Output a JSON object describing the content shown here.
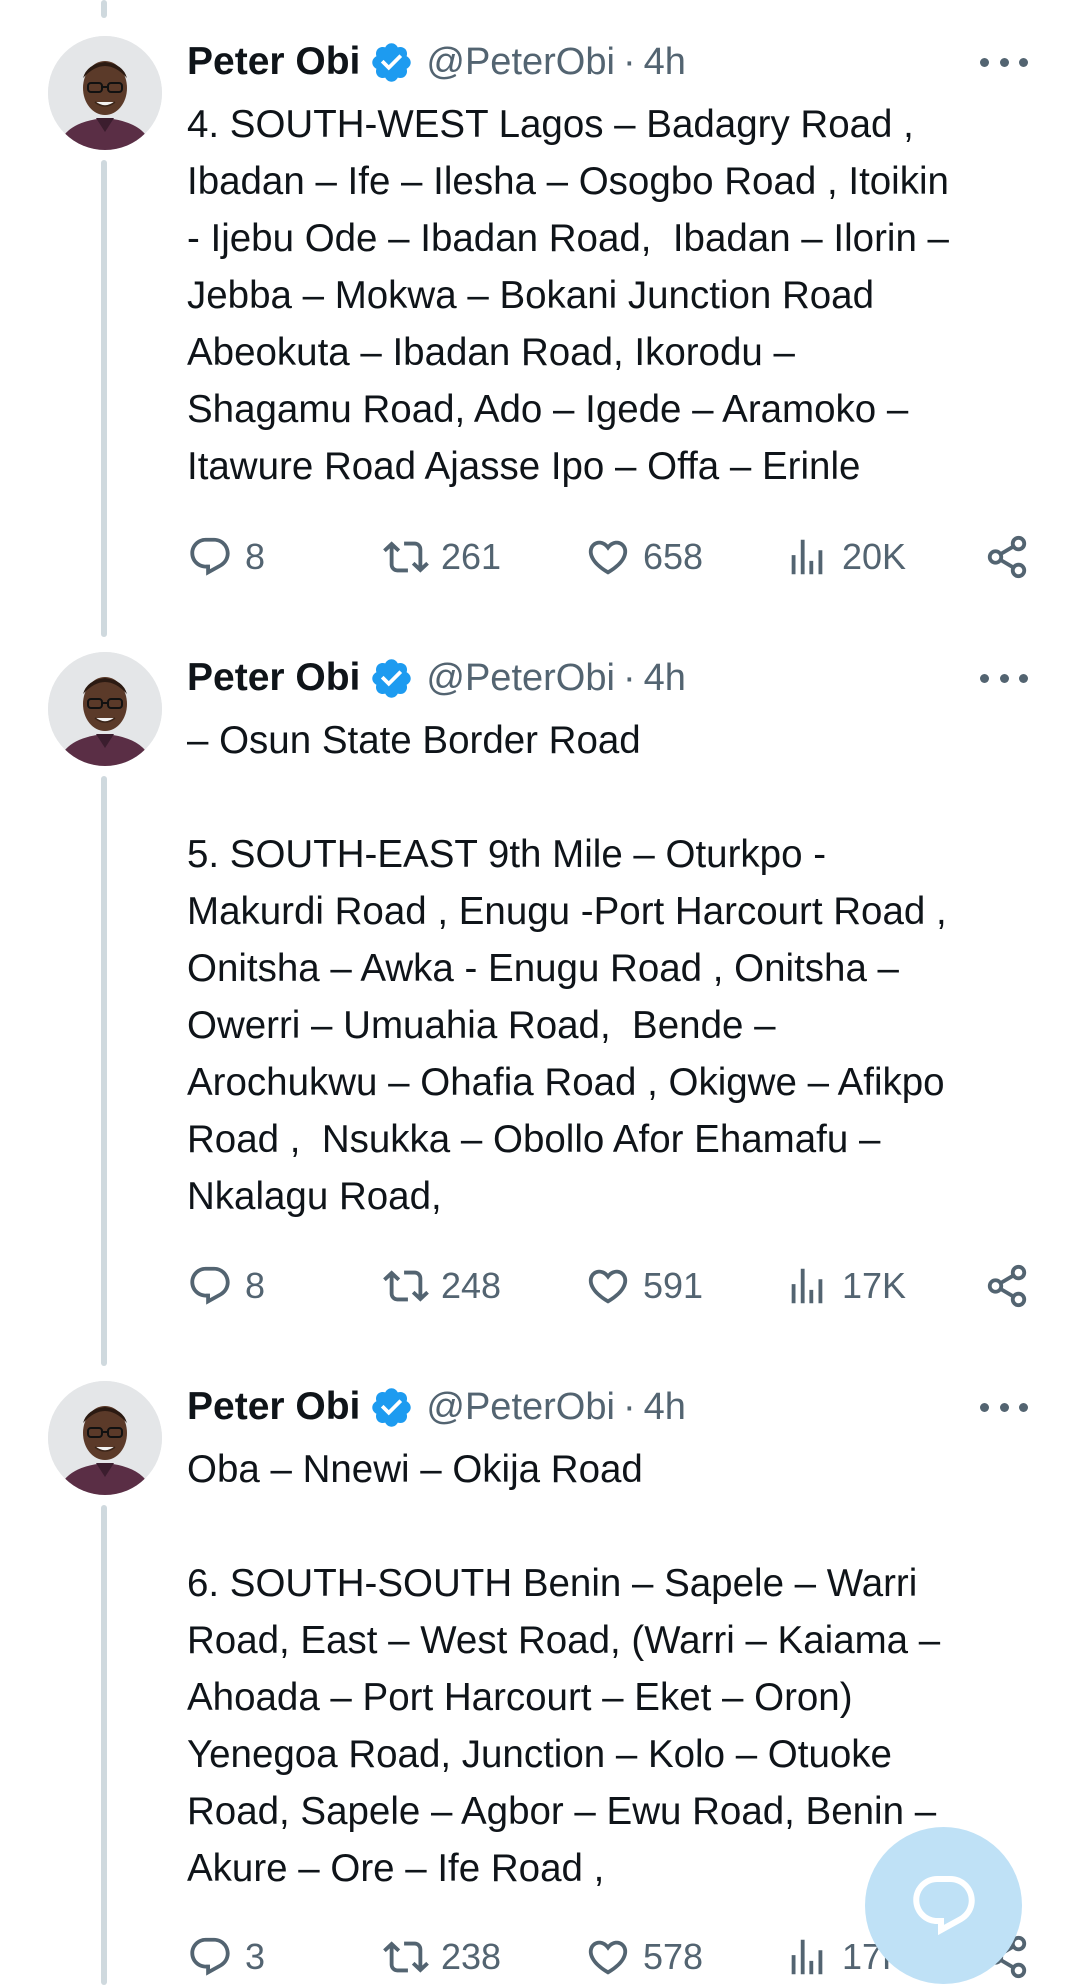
{
  "tweets": [
    {
      "name": "Peter Obi",
      "handle": "@PeterObi",
      "dot": "·",
      "time": "4h",
      "text": "4. SOUTH-WEST Lagos – Badagry Road ,\nIbadan – Ife – Ilesha – Osogbo Road , Itoikin\n- Ijebu Ode – Ibadan Road,  Ibadan – Ilorin –\nJebba – Mokwa – Bokani Junction Road\nAbeokuta – Ibadan Road, Ikorodu –\nShagamu Road, Ado – Igede – Aramoko –\nItawure Road Ajasse Ipo – Offa – Erinle",
      "replies": "8",
      "retweets": "261",
      "likes": "658",
      "views": "20K"
    },
    {
      "name": "Peter Obi",
      "handle": "@PeterObi",
      "dot": "·",
      "time": "4h",
      "text": "– Osun State Border Road\n\n5. SOUTH-EAST 9th Mile – Oturkpo -\nMakurdi Road , Enugu -Port Harcourt Road ,\nOnitsha – Awka - Enugu Road , Onitsha –\nOwerri – Umuahia Road,  Bende –\nArochukwu – Ohafia Road , Okigwe – Afikpo\nRoad ,  Nsukka – Obollo Afor Ehamafu –\nNkalagu Road,",
      "replies": "8",
      "retweets": "248",
      "likes": "591",
      "views": "17K"
    },
    {
      "name": "Peter Obi",
      "handle": "@PeterObi",
      "dot": "·",
      "time": "4h",
      "text": "Oba – Nnewi – Okija Road\n\n6. SOUTH-SOUTH Benin – Sapele – Warri\nRoad, East – West Road, (Warri – Kaiama –\nAhoada – Port Harcourt – Eket – Oron)\nYenegoa Road, Junction – Kolo – Otuoke\nRoad, Sapele – Agbor – Ewu Road, Benin –\nAkure – Ore – Ife Road ,",
      "replies": "3",
      "retweets": "238",
      "likes": "578",
      "views": "17K"
    }
  ],
  "icons": {
    "verified": "verified-badge-icon",
    "more": "more-icon",
    "reply": "reply-icon",
    "retweet": "retweet-icon",
    "like": "like-icon",
    "views": "views-icon",
    "share": "share-icon",
    "compose": "compose-icon"
  },
  "colors": {
    "text": "#0f1419",
    "secondary": "#536471",
    "verified": "#1d9bf0",
    "thread_line": "#cfd9de",
    "fab": "#bfe1f6"
  }
}
